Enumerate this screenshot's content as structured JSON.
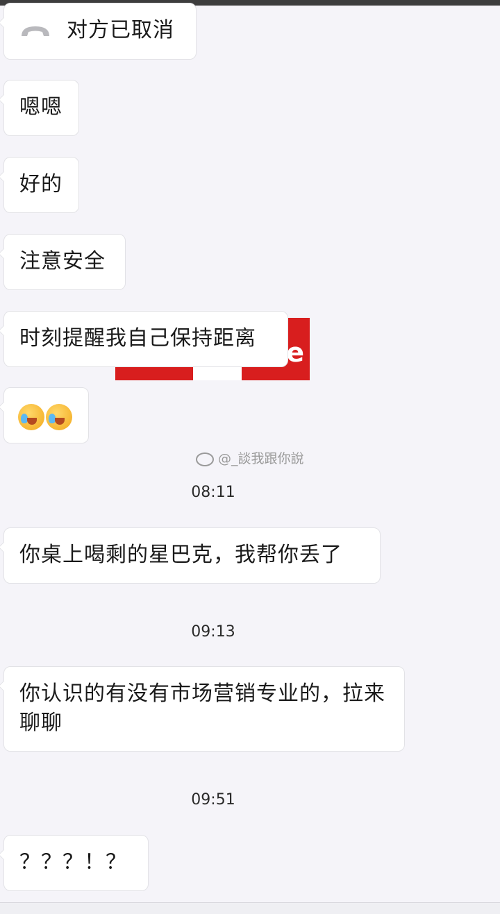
{
  "messages": {
    "call_cancelled": "对方已取消",
    "m1": "嗯嗯",
    "m2": "好的",
    "m3": "注意安全",
    "m4": "时刻提醒我自己保持距离",
    "m6": "你桌上喝剩的星巴克，我帮你丢了",
    "m7": "你认识的有没有市场营销专业的，拉来聊聊",
    "m8": "？？？！？"
  },
  "emoji": {
    "name": "facepalm-crying-emoji",
    "count": 2
  },
  "timestamps": {
    "t1": "08:11",
    "t2": "09:13",
    "t3": "09:51"
  },
  "sticker": {
    "letter": "e"
  },
  "watermark": {
    "text": "@_談我跟你說"
  },
  "colors": {
    "background": "#f5f4f9",
    "bubble": "#ffffff",
    "sticker_red": "#d81e1e",
    "top_bar": "#3d3d3d"
  },
  "icons": {
    "call": "phone-hangup-icon",
    "weibo": "weibo-icon"
  }
}
